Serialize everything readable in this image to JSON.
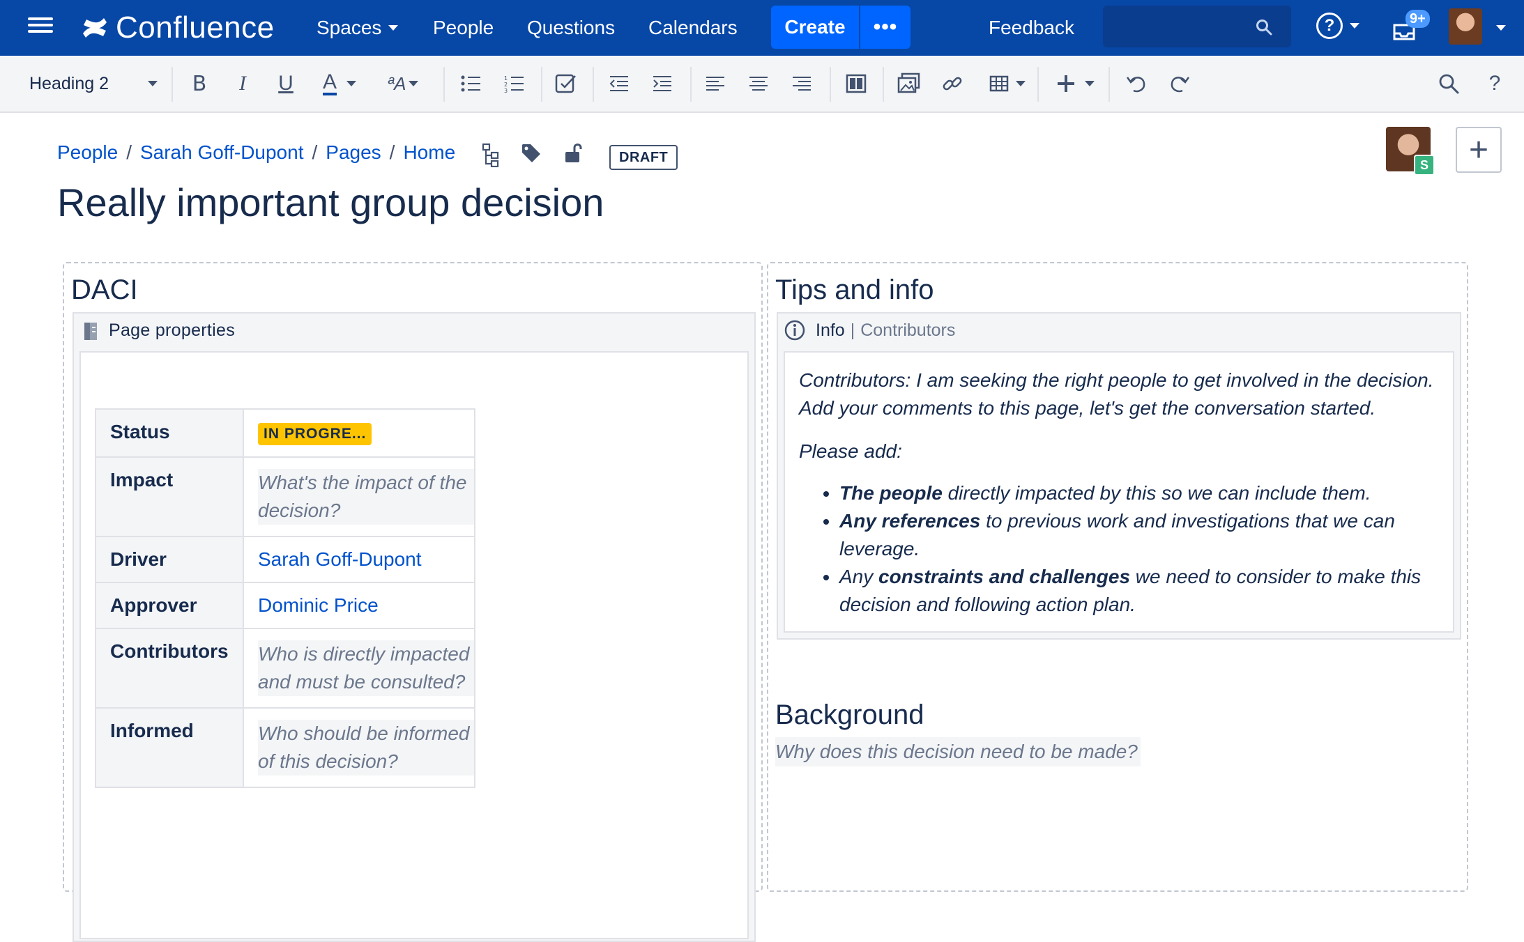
{
  "app": {
    "name": "Confluence",
    "accent": "#0747a6",
    "create_color": "#0065ff"
  },
  "nav": {
    "spaces": "Spaces",
    "people": "People",
    "questions": "Questions",
    "calendars": "Calendars",
    "create": "Create",
    "more": "•••",
    "feedback": "Feedback",
    "notifications_badge": "9+"
  },
  "toolbar": {
    "text_style": "Heading 2",
    "bold": "B",
    "italic": "I",
    "underline": "U",
    "text_color": "A",
    "more_formatting": "ªA",
    "help": "?"
  },
  "breadcrumb": {
    "items": [
      "People",
      "Sarah Goff-Dupont",
      "Pages",
      "Home"
    ],
    "separator": "/"
  },
  "page": {
    "status_label": "DRAFT",
    "title": "Really important group decision",
    "collaborator_initial": "S",
    "add_label": "+"
  },
  "daci": {
    "heading": "DACI",
    "macro_title": "Page properties",
    "rows": [
      {
        "key": "Status",
        "value": "IN PROGRE...",
        "kind": "status",
        "color": "#ffc400"
      },
      {
        "key": "Impact",
        "value": "What's the impact of the decision?",
        "kind": "placeholder"
      },
      {
        "key": "Driver",
        "value": "Sarah Goff-Dupont",
        "kind": "user"
      },
      {
        "key": "Approver",
        "value": "Dominic Price",
        "kind": "user"
      },
      {
        "key": "Contributors",
        "value": "Who is directly impacted and must be consulted?",
        "kind": "placeholder"
      },
      {
        "key": "Informed",
        "value": "Who should be informed of this decision?",
        "kind": "placeholder"
      }
    ]
  },
  "tips": {
    "heading": "Tips and info",
    "macro_title": "Info",
    "macro_param": "Contributors",
    "intro": "Contributors: I am seeking the right people to get involved in the decision. Add your comments to this page, let's get the conversation started.",
    "please_add": "Please add:",
    "bullets": [
      {
        "pre": "",
        "bold": "The people",
        "post": " directly impacted by this so we can include them."
      },
      {
        "pre": "",
        "bold": "Any references",
        "post": " to previous work and investigations that we can leverage."
      },
      {
        "pre": "Any ",
        "bold": "constraints and challenges",
        "post": " we need to consider to make this decision and following action plan."
      }
    ]
  },
  "background": {
    "heading": "Background",
    "placeholder": "Why does this decision need to be made?"
  }
}
